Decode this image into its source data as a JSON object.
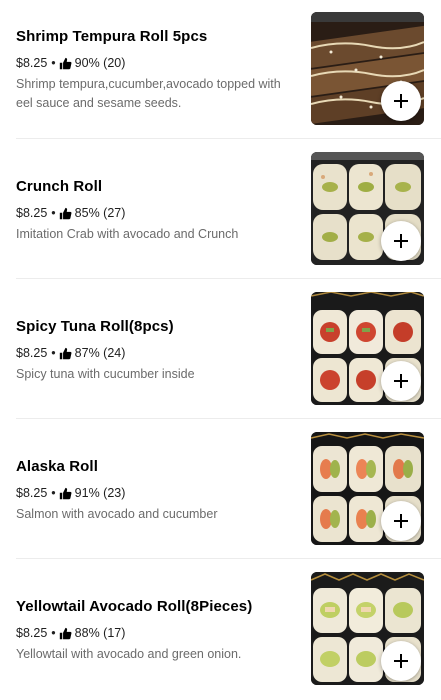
{
  "menu_items": [
    {
      "title": "Shrimp Tempura Roll 5pcs",
      "price": "$8.25",
      "separator": "•",
      "rating": "90% (20)",
      "description": "Shrimp tempura,cucumber,avocado topped with eel sauce and sesame seeds.",
      "add_icon": "plus-icon"
    },
    {
      "title": "Crunch Roll",
      "price": "$8.25",
      "separator": "•",
      "rating": "85% (27)",
      "description": "Imitation Crab with avocado and Crunch",
      "add_icon": "plus-icon"
    },
    {
      "title": "Spicy Tuna Roll(8pcs)",
      "price": "$8.25",
      "separator": "•",
      "rating": "87% (24)",
      "description": "Spicy tuna with cucumber inside",
      "add_icon": "plus-icon"
    },
    {
      "title": "Alaska Roll",
      "price": "$8.25",
      "separator": "•",
      "rating": "91% (23)",
      "description": "Salmon with avocado and cucumber",
      "add_icon": "plus-icon"
    },
    {
      "title": "Yellowtail Avocado Roll(8Pieces)",
      "price": "$8.25",
      "separator": "•",
      "rating": "88% (17)",
      "description": "Yellowtail with avocado and green onion.",
      "add_icon": "plus-icon"
    }
  ],
  "icons": {
    "rating": "thumbs-up-icon",
    "add": "plus-icon"
  }
}
